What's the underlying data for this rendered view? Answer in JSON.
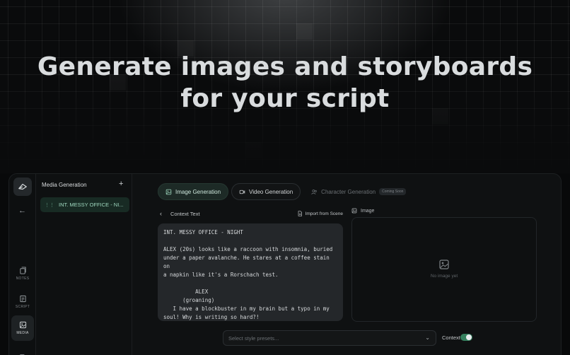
{
  "hero": {
    "title_line1": "Generate images and storyboards",
    "title_line2": "for your script"
  },
  "rail": {
    "items": [
      {
        "label": "NOTES",
        "icon": "notes-icon"
      },
      {
        "label": "SCRIPT",
        "icon": "script-icon"
      },
      {
        "label": "MEDIA",
        "icon": "media-icon",
        "active": true
      }
    ]
  },
  "panel": {
    "title": "Media Generation",
    "add_label": "+",
    "scenes": [
      "INT. MESSY OFFICE - NI..."
    ]
  },
  "tabs": [
    {
      "label": "Image Generation",
      "active": true
    },
    {
      "label": "Video Generation"
    },
    {
      "label": "Character Generation",
      "badge": "Coming Soon",
      "disabled": true
    }
  ],
  "context": {
    "label": "Context Text",
    "import_label": "Import from Scene",
    "script_text": "INT. MESSY OFFICE - NIGHT\n\nALEX (20s) looks like a raccoon with insomnia, buried\nunder a paper avalanche. He stares at a coffee stain on\na napkin like it's a Rorschach test.\n\n          ALEX\n      (groaning)\n   I have a blockbuster in my brain but a typo in my\nsoul! Why is writing so hard?!"
  },
  "image": {
    "label": "Image",
    "empty_text": "No image yet"
  },
  "controls": {
    "preset_placeholder": "Select style presets...",
    "context_toggle_label": "Context",
    "context_enabled": true
  },
  "colors": {
    "accent_green": "#35805e",
    "active_tab_bg": "#1d2a26"
  }
}
